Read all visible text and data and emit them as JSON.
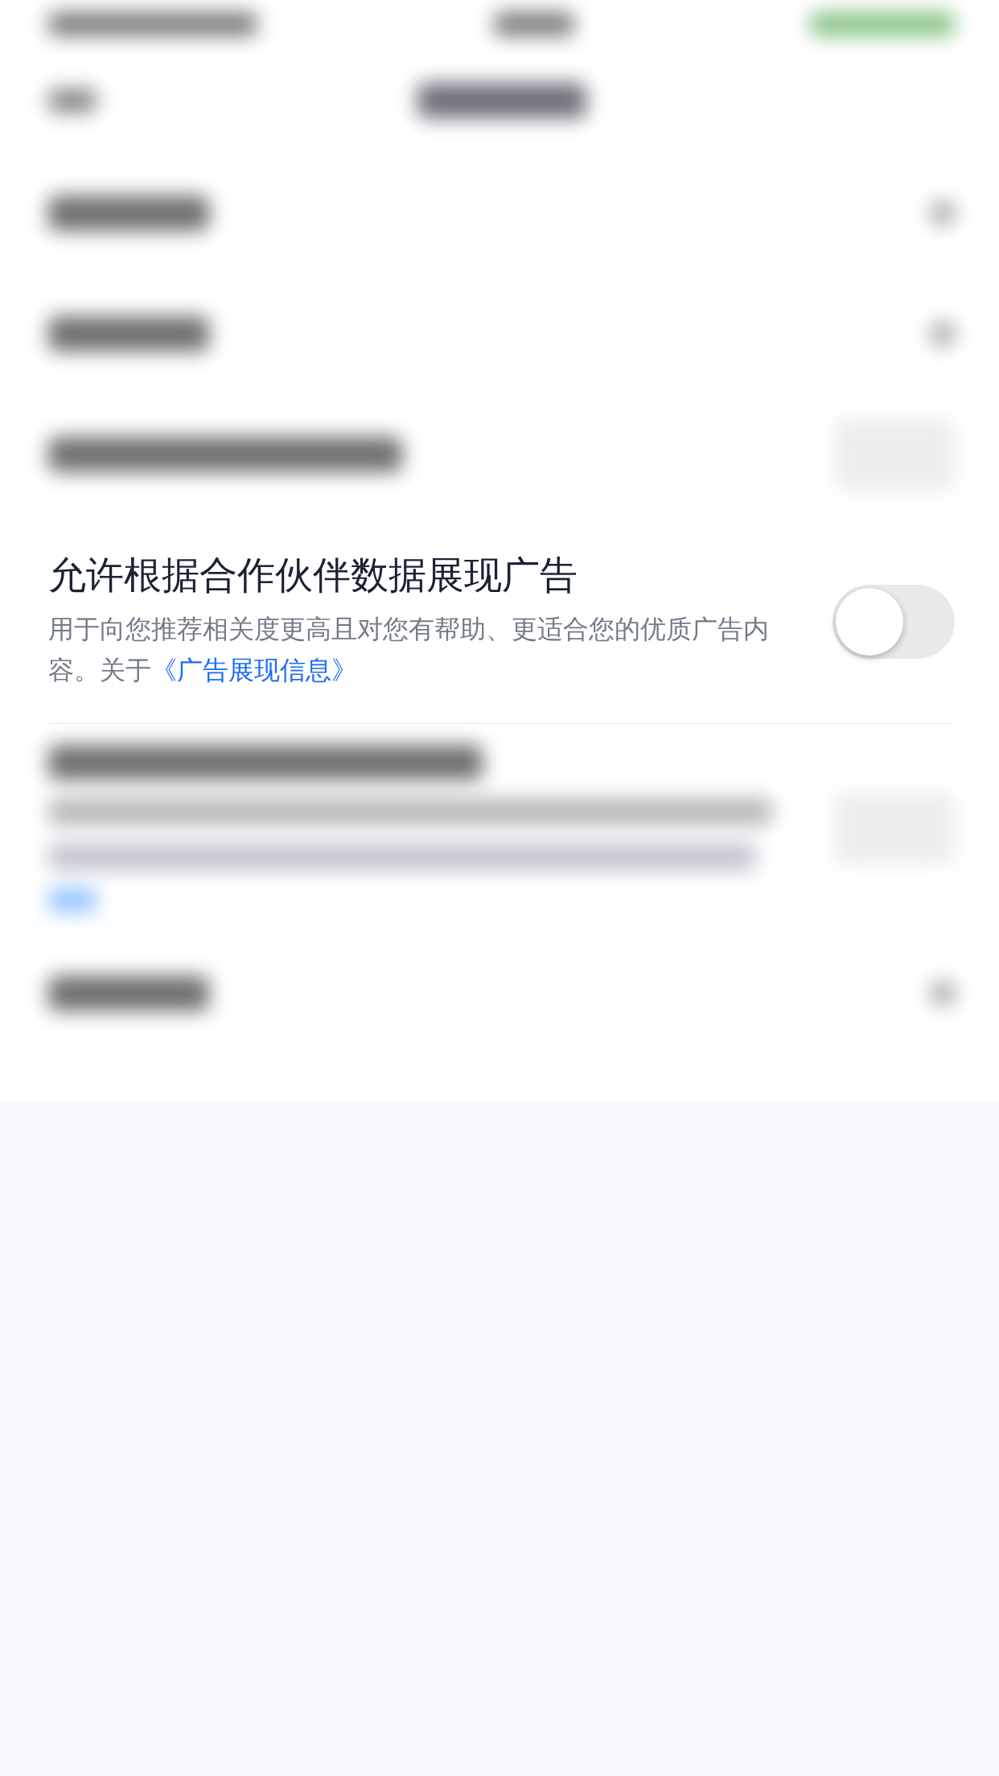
{
  "blurred_rows": [
    {
      "kind": "status"
    },
    {
      "kind": "nav"
    },
    {
      "kind": "chevron"
    },
    {
      "kind": "chevron"
    },
    {
      "kind": "toggle"
    }
  ],
  "setting": {
    "title": "允许根据合作伙伴数据展现广告",
    "description": "用于向您推荐相关度更高且对您有帮助、更适合您的优质广告内容。关于",
    "link": "《广告展现信息》",
    "toggle": {
      "on": false
    }
  },
  "blurred_rows_below": [
    {
      "kind": "toggle_desc"
    },
    {
      "kind": "chevron"
    }
  ]
}
